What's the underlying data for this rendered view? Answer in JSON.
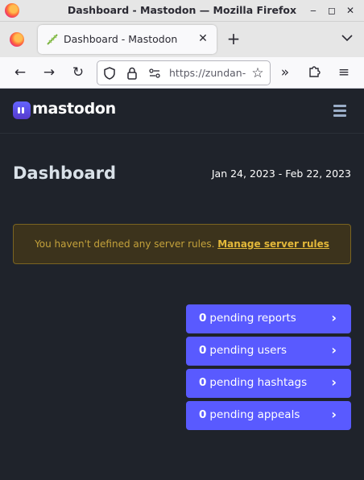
{
  "window": {
    "title": "Dashboard - Mastodon — Mozilla Firefox",
    "minimize": "‒",
    "maximize": "◻",
    "close": "✕"
  },
  "tabs": [
    {
      "label": "Dashboard - Mastodon",
      "active": true
    }
  ],
  "toolbar": {
    "new_tab": "+",
    "list_tabs": "⌄",
    "back": "←",
    "forward": "→",
    "reload": "↻",
    "overflow": "»",
    "extensions": "⧉",
    "menu": "≡"
  },
  "urlbar": {
    "url": "https://zundan-ma",
    "star": "☆"
  },
  "site": {
    "logo_text": "mastodon"
  },
  "dashboard": {
    "title": "Dashboard",
    "date_range": "Jan 24, 2023 - Feb 22, 2023"
  },
  "notice": {
    "text": "You haven't defined any server rules.",
    "link": "Manage server rules"
  },
  "pending": [
    {
      "count": "0",
      "label": "pending reports"
    },
    {
      "count": "0",
      "label": "pending users"
    },
    {
      "count": "0",
      "label": "pending hashtags"
    },
    {
      "count": "0",
      "label": "pending appeals"
    }
  ],
  "colors": {
    "accent": "#595aff",
    "page_bg": "#1f232b",
    "warning_text": "#c4a23b"
  }
}
